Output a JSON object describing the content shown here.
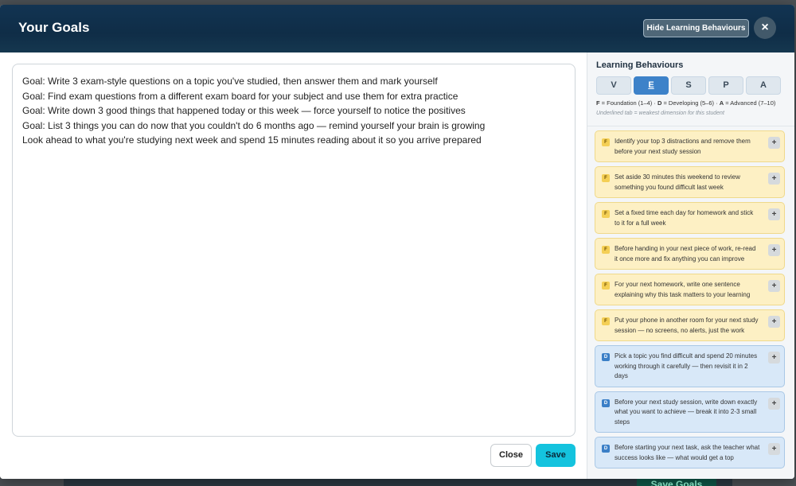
{
  "backdrop": {
    "save_label": "Save Goals"
  },
  "modal": {
    "title": "Your Goals",
    "hide_button": "Hide Learning Behaviours",
    "close_icon": "×"
  },
  "goals": [
    "Goal: Write 3 exam-style questions on a topic you've studied, then answer them and mark yourself",
    "Goal: Find exam questions from a different exam board for your subject and use them for extra practice",
    "Goal: Write down 3 good things that happened today or this week — force yourself to notice the positives",
    "Goal: List 3 things you can do now that you couldn't do 6 months ago — remind yourself your brain is growing",
    "Look ahead to what you're studying next week and spend 15 minutes reading about it so you arrive prepared"
  ],
  "buttons": {
    "close": "Close",
    "save": "Save"
  },
  "sidebar": {
    "title": "Learning Behaviours",
    "tabs": [
      "V",
      "E",
      "S",
      "P",
      "A"
    ],
    "active_tab": "E",
    "legend": {
      "f_key": "F",
      "f_text": " = Foundation (1–4) · ",
      "d_key": "D",
      "d_text": " = Developing (5–6) · ",
      "a_key": "A",
      "a_text": " = Advanced (7–10)"
    },
    "note": "Underlined tab = weakest dimension for this student",
    "plus": "+",
    "cards": [
      {
        "level": "F",
        "text": "Identify your top 3 distractions and remove them before your next study session"
      },
      {
        "level": "F",
        "text": "Set aside 30 minutes this weekend to review something you found difficult last week"
      },
      {
        "level": "F",
        "text": "Set a fixed time each day for homework and stick to it for a full week"
      },
      {
        "level": "F",
        "text": "Before handing in your next piece of work, re-read it once more and fix anything you can improve"
      },
      {
        "level": "F",
        "text": "For your next homework, write one sentence explaining why this task matters to your learning"
      },
      {
        "level": "F",
        "text": "Put your phone in another room for your next study session — no screens, no alerts, just the work"
      },
      {
        "level": "D",
        "text": "Pick a topic you find difficult and spend 20 minutes working through it carefully — then revisit it in 2 days"
      },
      {
        "level": "D",
        "text": "Before your next study session, write down exactly what you want to achieve — break it into 2-3 small steps"
      },
      {
        "level": "D",
        "text": "Before starting your next task, ask the teacher what success looks like — what would get a top"
      }
    ]
  }
}
